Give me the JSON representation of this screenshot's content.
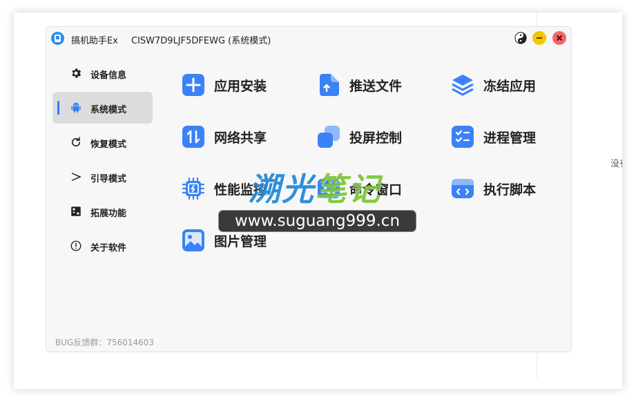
{
  "window": {
    "app_title": "搞机助手Ex",
    "device_title": "CISW7D9LJF5DFEWG (系统模式)"
  },
  "sidebar": {
    "items": [
      {
        "label": "设备信息",
        "icon": "gear-icon",
        "active": false
      },
      {
        "label": "系统模式",
        "icon": "android-icon",
        "active": true
      },
      {
        "label": "恢复模式",
        "icon": "refresh-icon",
        "active": false
      },
      {
        "label": "引导模式",
        "icon": "chevron-right-icon",
        "active": false
      },
      {
        "label": "拓展功能",
        "icon": "extension-icon",
        "active": false
      },
      {
        "label": "关于软件",
        "icon": "info-icon",
        "active": false
      }
    ]
  },
  "features": [
    {
      "label": "应用安装",
      "icon": "plus-icon"
    },
    {
      "label": "推送文件",
      "icon": "upload-file-icon"
    },
    {
      "label": "冻结应用",
      "icon": "layers-icon"
    },
    {
      "label": "网络共享",
      "icon": "network-share-icon"
    },
    {
      "label": "投屏控制",
      "icon": "screen-mirror-icon"
    },
    {
      "label": "进程管理",
      "icon": "checklist-icon"
    },
    {
      "label": "性能监控",
      "icon": "cpu-icon"
    },
    {
      "label": "命令窗口",
      "icon": "terminal-icon"
    },
    {
      "label": "执行脚本",
      "icon": "code-icon"
    },
    {
      "label": "图片管理",
      "icon": "image-icon"
    }
  ],
  "footer": {
    "bug_text": "BUG反馈群：756014603"
  },
  "watermark": {
    "cn_part1": "溯光",
    "cn_part2": "笔记",
    "url": "www.suguang999.cn"
  },
  "background_cut_text": "没有",
  "colors": {
    "accent": "#2d7ff9",
    "icon_blue": "#3b82f6",
    "minimize": "#f7c400",
    "close": "#f2686a"
  }
}
